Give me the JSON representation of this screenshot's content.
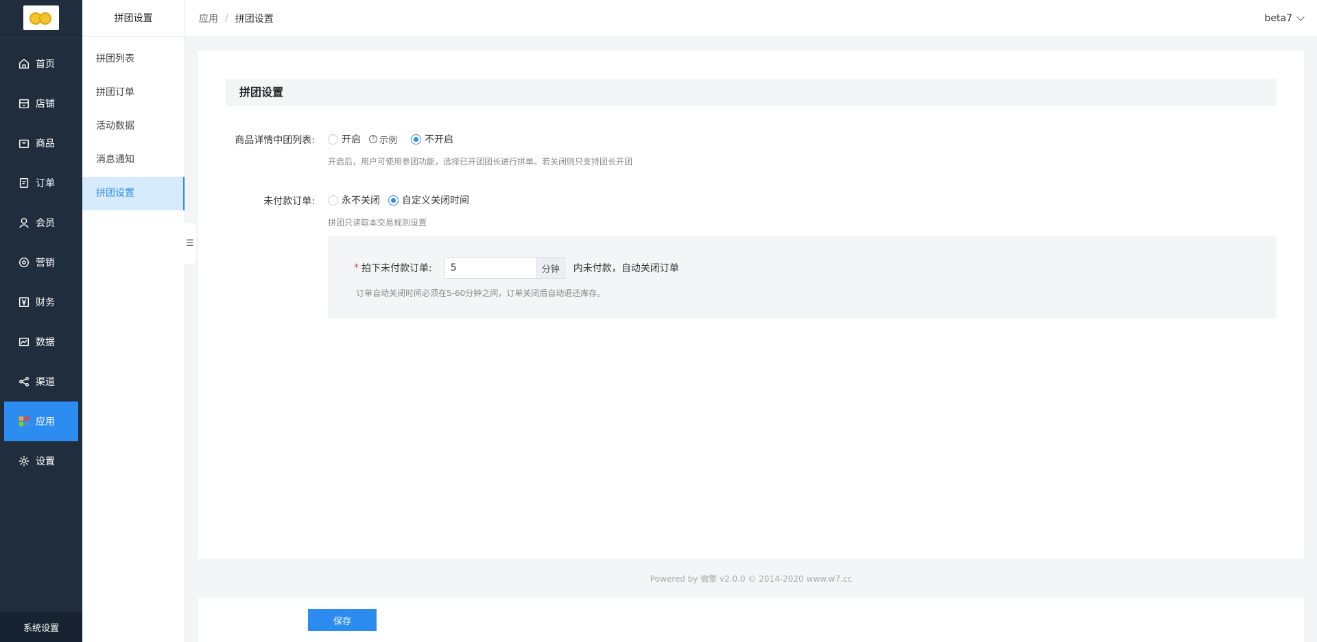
{
  "sidebar": {
    "logo_alt": "logo",
    "items": [
      {
        "label": "首页",
        "icon": "home-icon"
      },
      {
        "label": "店铺",
        "icon": "store-icon"
      },
      {
        "label": "商品",
        "icon": "bag-icon"
      },
      {
        "label": "订单",
        "icon": "order-icon"
      },
      {
        "label": "会员",
        "icon": "user-icon"
      },
      {
        "label": "营销",
        "icon": "marketing-icon"
      },
      {
        "label": "财务",
        "icon": "finance-icon"
      },
      {
        "label": "数据",
        "icon": "chart-icon"
      },
      {
        "label": "渠道",
        "icon": "share-icon"
      },
      {
        "label": "应用",
        "icon": "apps-icon",
        "active": true
      },
      {
        "label": "设置",
        "icon": "gear-icon"
      }
    ],
    "bottom_label": "系统设置"
  },
  "subnav": {
    "title": "拼团设置",
    "items": [
      {
        "label": "拼团列表"
      },
      {
        "label": "拼团订单"
      },
      {
        "label": "活动数据"
      },
      {
        "label": "消息通知"
      },
      {
        "label": "拼团设置",
        "active": true
      }
    ],
    "collapse_icon": "menu-collapse-icon"
  },
  "header": {
    "breadcrumb": [
      "应用",
      "拼团设置"
    ],
    "separator": "/",
    "user": "beta7"
  },
  "main": {
    "section_title": "拼团设置",
    "group_list": {
      "label": "商品详情中团列表:",
      "option_on": "开启",
      "example_label": "示例",
      "option_off": "不开启",
      "selected": "不开启",
      "help": "开启后，用户可使用参团功能，选择已开团团长进行拼单。若关闭则只支持团长开团"
    },
    "unpaid": {
      "label": "未付款订单:",
      "option_never": "永不关闭",
      "option_custom": "自定义关闭时间",
      "selected": "自定义关闭时间",
      "help": "拼团只读取本交易规则设置"
    },
    "close_time": {
      "required_mark": "*",
      "label": "拍下未付款订单:",
      "value": "5",
      "unit": "分钟",
      "after_text": "内未付款，自动关闭订单",
      "help": "订单自动关闭时间必须在5-60分钟之间，订单关闭后自动退还库存。"
    }
  },
  "footer": {
    "powered": "Powered by 微擎 v2.0.0 © 2014-2020 www.w7.cc"
  },
  "actions": {
    "save_label": "保存"
  },
  "colors": {
    "primary": "#2d8cf0",
    "sidebar_bg": "#1f2d3d",
    "required": "#e83a3a"
  }
}
